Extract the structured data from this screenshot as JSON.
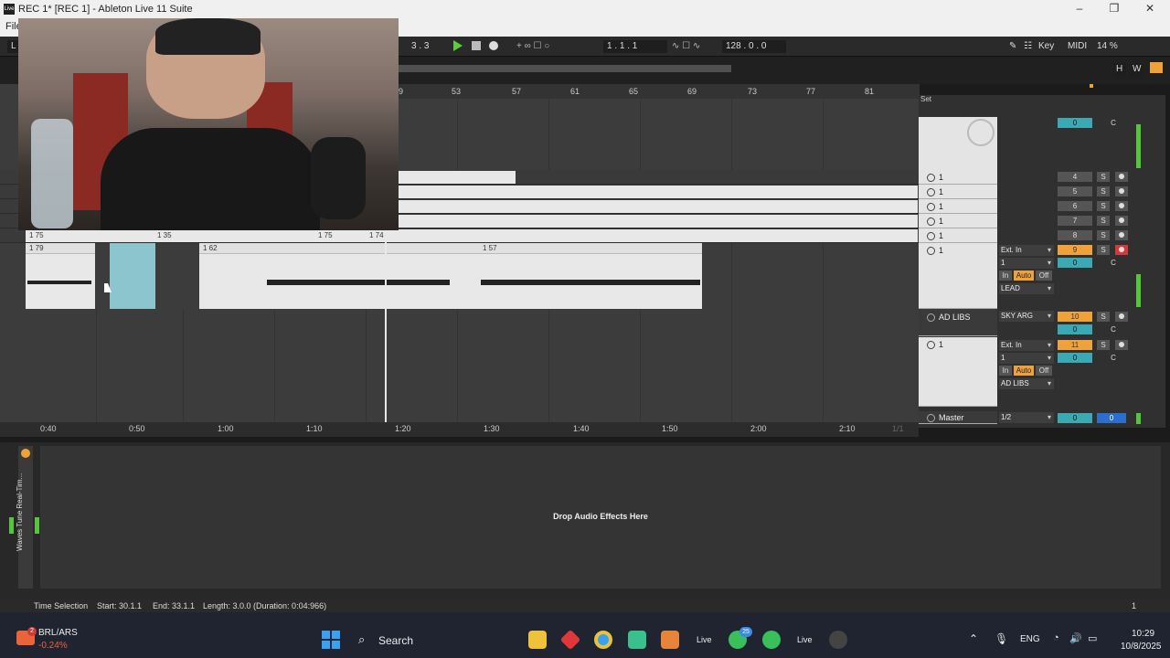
{
  "window": {
    "title": "REC 1*  [REC 1] - Ableton Live 11 Suite",
    "app_icon": "Live"
  },
  "menu": {
    "first_item": "File"
  },
  "control_bar": {
    "left_label": "L",
    "signature": "3 .  3",
    "position": "1 .  1 .  1",
    "tempo": "128 .  0 .  0",
    "key_label": "Key",
    "midi_label": "MIDI",
    "cpu": "14 %",
    "h_btn": "H",
    "w_btn": "W"
  },
  "ruler_bars": [
    "9",
    "53",
    "57",
    "61",
    "65",
    "69",
    "73",
    "77",
    "81"
  ],
  "clip_markers": [
    "1 75",
    "1 35",
    "1 75",
    "1 74",
    "1 79",
    "1 62",
    "1 57"
  ],
  "time_labels": [
    "0:40",
    "0:50",
    "1:00",
    "1:10",
    "1:20",
    "1:30",
    "1:40",
    "1:50",
    "2:00",
    "2:10"
  ],
  "set_label": "Set",
  "tracks": [
    {
      "name": "1",
      "num": "4",
      "s": "S"
    },
    {
      "name": "1",
      "num": "5",
      "s": "S"
    },
    {
      "name": "1",
      "num": "6",
      "s": "S"
    },
    {
      "name": "1",
      "num": "7",
      "s": "S"
    },
    {
      "name": "1",
      "num": "8",
      "s": "S"
    }
  ],
  "top_track_value": "0",
  "top_track_c": "C",
  "lead_track": {
    "name": "1",
    "input": "Ext. In",
    "channel": "1",
    "num": "9",
    "s": "S",
    "vol": "0",
    "pan": "C",
    "in": "In",
    "auto": "Auto",
    "off": "Off",
    "group": "LEAD"
  },
  "adlibs_group": {
    "name": "AD LIBS",
    "route": "SKY ARG",
    "num": "10",
    "s": "S",
    "vol": "0",
    "pan": "C"
  },
  "adlibs_track": {
    "name": "1",
    "input": "Ext. In",
    "channel": "1",
    "num": "11",
    "s": "S",
    "vol": "0",
    "pan": "C",
    "in": "In",
    "auto": "Auto",
    "off": "Off",
    "group": "AD LIBS"
  },
  "master": {
    "name": "Master",
    "route": "1/2",
    "vol": "0",
    "pan": "0"
  },
  "page_indicator": "1/1",
  "device": {
    "name": "Waves Tune Real-Tim...",
    "drop_text": "Drop Audio Effects Here"
  },
  "status_bar": {
    "mode": "Time Selection",
    "start": "Start: 30.1.1",
    "end": "End: 33.1.1",
    "length": "Length: 3.0.0 (Duration: 0:04:966)",
    "right_num": "1"
  },
  "taskbar": {
    "ticker": "BRL/ARS",
    "ticker_change": "-0.24%",
    "ticker_badge": "2",
    "search_placeholder": "Search",
    "whatsapp_badge": "25",
    "live_label": "Live",
    "lang": "ENG",
    "time": "10:29",
    "date": "10/8/2025"
  }
}
